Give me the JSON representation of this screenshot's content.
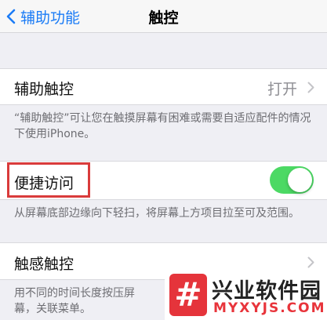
{
  "nav": {
    "back_label": "辅助功能",
    "title": "触控"
  },
  "assistive_touch": {
    "label": "辅助触控",
    "value": "打开",
    "footer": "“辅助触控”可让您在触摸屏幕有困难或需要自适应配件的情况下使用iPhone。"
  },
  "reachability": {
    "label": "便捷访问",
    "toggle_on": true,
    "footer": "从屏幕底部边缘向下轻扫，将屏幕上方项目拉至可及范围。"
  },
  "haptic_touch": {
    "label": "触感触控",
    "footer": "用不同的时间长度按压屏幕，关联菜单。"
  },
  "watermark": {
    "logo_glyph": "#",
    "title": "兴业软件园",
    "subtitle": "MYXYJS.COM"
  },
  "colors": {
    "accent": "#1b7cf6",
    "toggle_on": "#4cd964",
    "highlight": "#d93b3b",
    "brand_red": "#e5343b"
  }
}
